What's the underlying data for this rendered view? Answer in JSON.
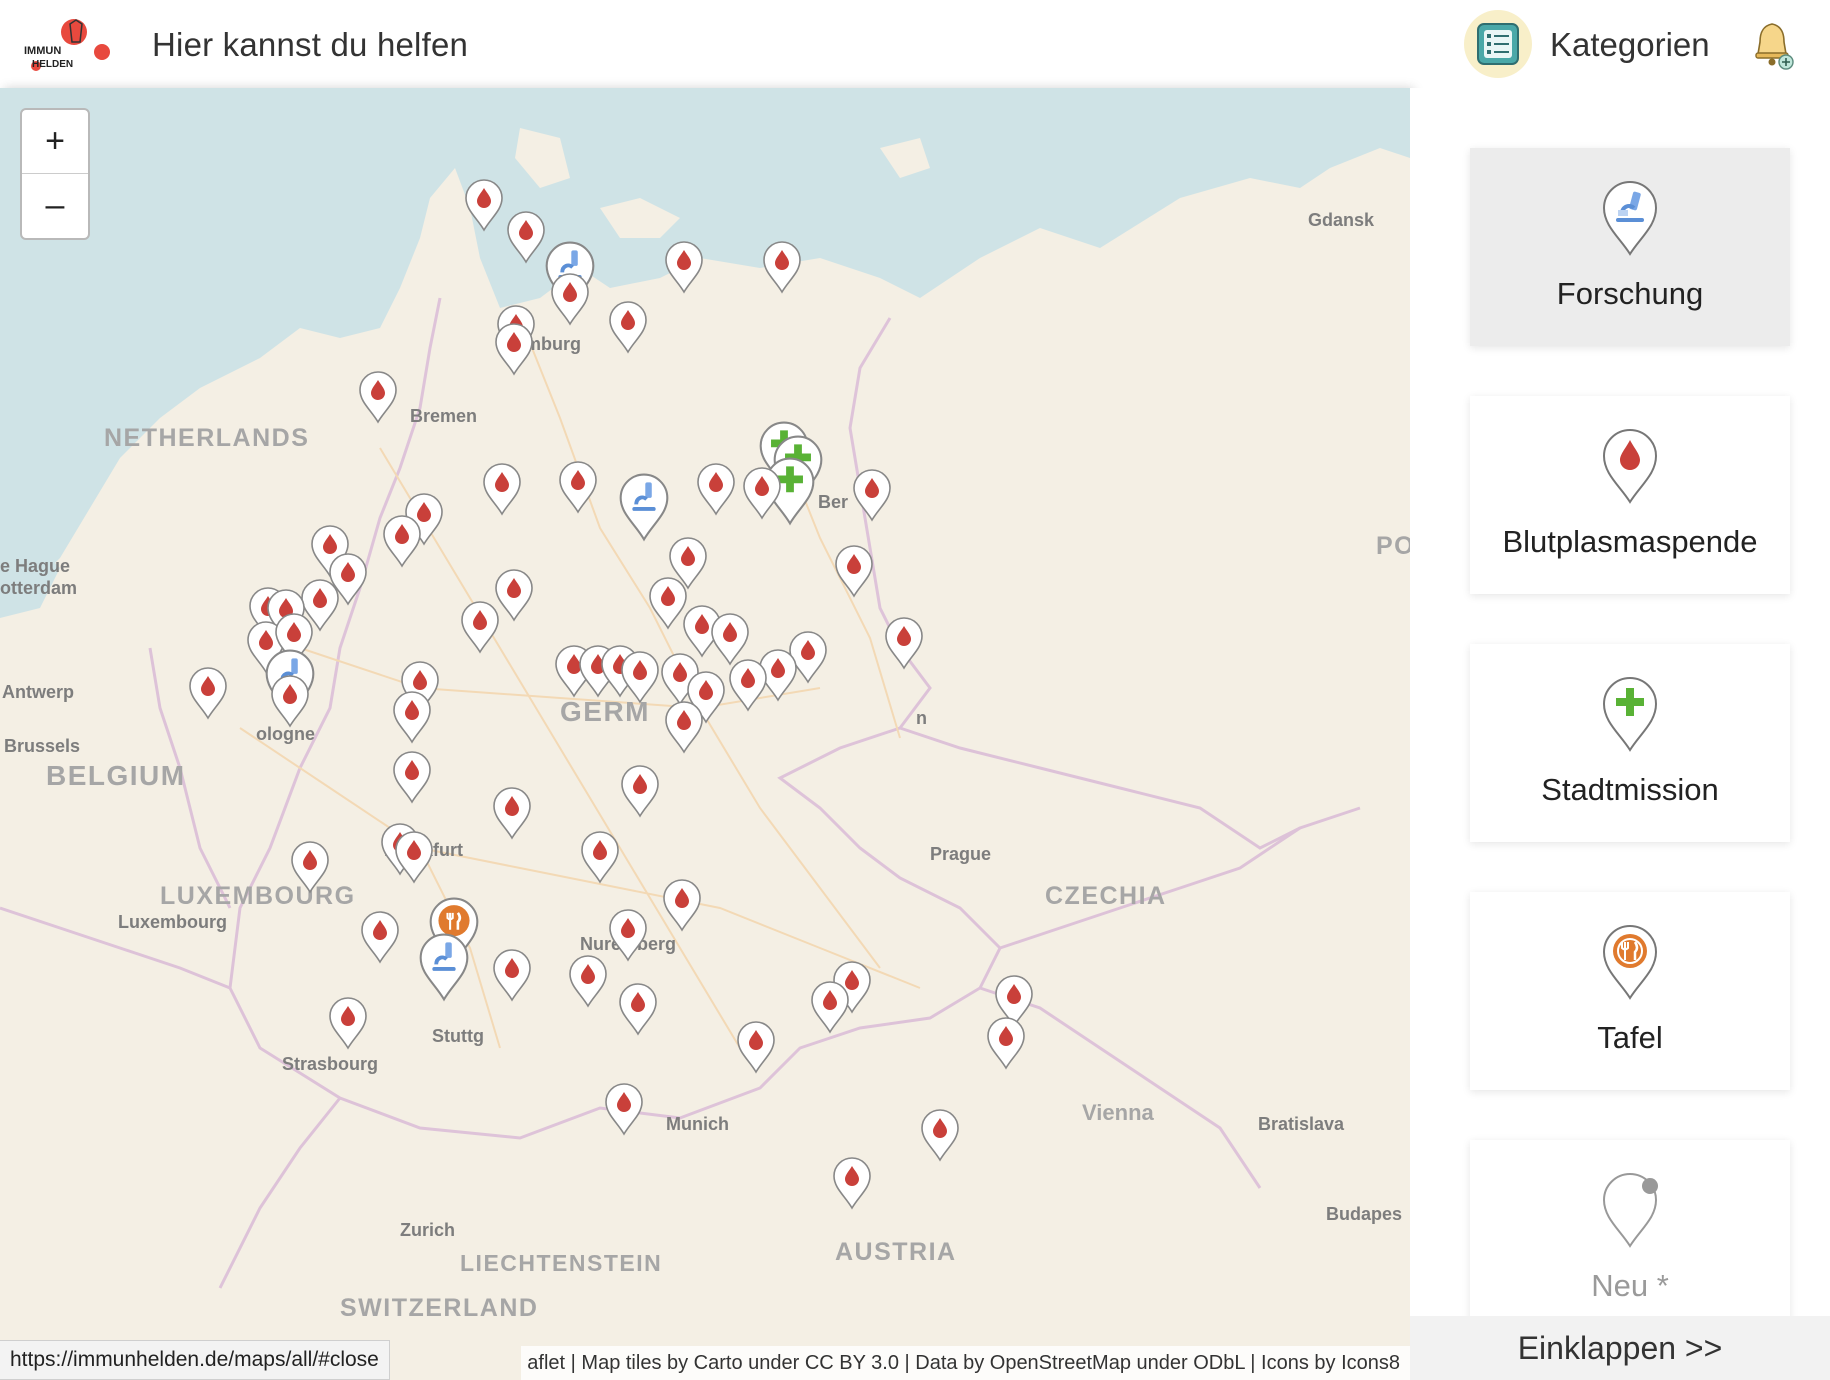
{
  "header": {
    "logo_text_top": "IMMUN",
    "logo_text_bottom": "HELDEN",
    "title": "Hier kannst du helfen",
    "categories_icon": "list-menu-icon",
    "categories_label": "Kategorien",
    "notification_icon": "bell-add-icon"
  },
  "map": {
    "zoom_in": "+",
    "zoom_out": "–",
    "countries": [
      "NETHERLANDS",
      "BELGIUM",
      "LUXEMBOURG",
      "GERM",
      "CZECHIA",
      "AUSTRIA",
      "SWITZERLAND",
      "LIECHTENSTEIN",
      "PO"
    ],
    "cities": [
      "Gdansk",
      "Hamburg",
      "Bremen",
      "e Hague",
      "otterdam",
      "Antwerp",
      "Brussels",
      "ologne",
      "Frankfurt",
      "Luxembourg",
      "Nuremberg",
      "Prague",
      "Strasbourg",
      "Stuttg",
      "Munich",
      "Vienna",
      "Bratislava",
      "Zurich",
      "Budapes",
      "n",
      "Ber"
    ],
    "attribution": "aflet | Map tiles by Carto under CC BY 3.0 | Data by OpenStreetMap under ODbL | Icons by Icons8",
    "status_url": "https://immunhelden.de/maps/all/#close",
    "marker_types": {
      "blood": "blood-drop-icon",
      "research": "microscope-icon",
      "mission": "green-cross-icon",
      "food": "cutlery-icon"
    },
    "colors": {
      "blood": "#c9403a",
      "research": "#5b8fd6",
      "mission": "#59b235",
      "food": "#e07a2e",
      "water": "#cfe3e6",
      "land": "#f4efe4"
    }
  },
  "sidebar": {
    "categories": [
      {
        "label": "Forschung",
        "icon": "microscope-icon",
        "active": true
      },
      {
        "label": "Blutplasmaspende",
        "icon": "blood-drop-icon",
        "active": false
      },
      {
        "label": "Stadtmission",
        "icon": "green-cross-icon",
        "active": false
      },
      {
        "label": "Tafel",
        "icon": "cutlery-icon",
        "active": false
      },
      {
        "label": "Neu *",
        "icon": "new-marker-icon",
        "active": false
      }
    ],
    "collapse_label": "Einklappen >>"
  }
}
